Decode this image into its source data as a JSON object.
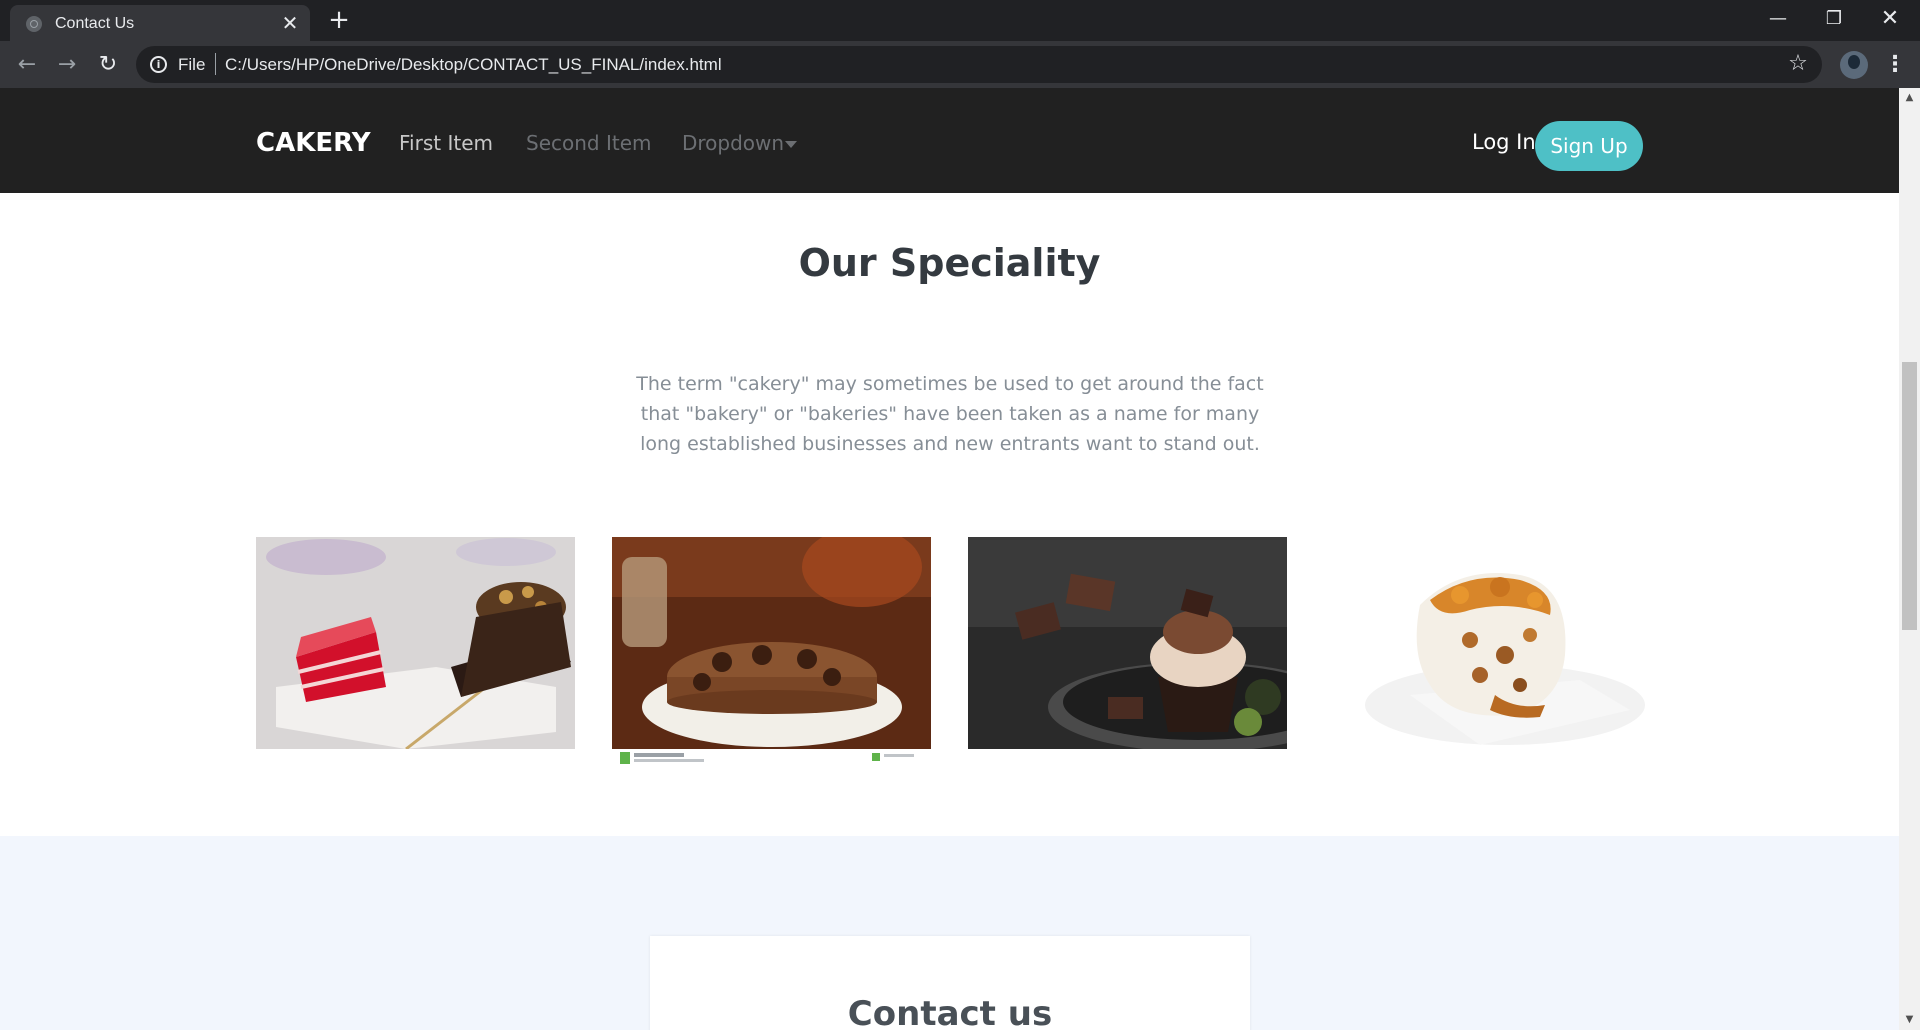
{
  "browser": {
    "tab_title": "Contact Us",
    "tab_close_glyph": "✕",
    "new_tab_glyph": "+",
    "url_scheme": "File",
    "url": "C:/Users/HP/OneDrive/Desktop/CONTACT_US_FINAL/index.html",
    "window_controls": {
      "minimize": "—",
      "maximize": "❐",
      "close": "✕"
    }
  },
  "site": {
    "brand": "CAKERY",
    "nav": {
      "first_item": "First Item",
      "second_item": "Second Item",
      "dropdown": "Dropdown"
    },
    "login_label": "Log In",
    "signup_label": "Sign Up",
    "signup_color": "#4ec0c6",
    "navbar_color": "#212121"
  },
  "specialty": {
    "title": "Our Speciality",
    "description": "The term \"cakery\" may sometimes be used to get around the fact that \"bakery\" or \"bakeries\" have been taken as a name for many long established businesses and new entrants want to stand out.",
    "images": [
      {
        "icon": "red-velvet-and-chocolate-cake-image"
      },
      {
        "icon": "chocolate-cake-on-plate-image"
      },
      {
        "icon": "chocolate-cupcake-image"
      },
      {
        "icon": "carrot-cake-slice-image"
      }
    ]
  },
  "contact": {
    "title": "Contact us",
    "band_color": "#f2f6fd"
  }
}
